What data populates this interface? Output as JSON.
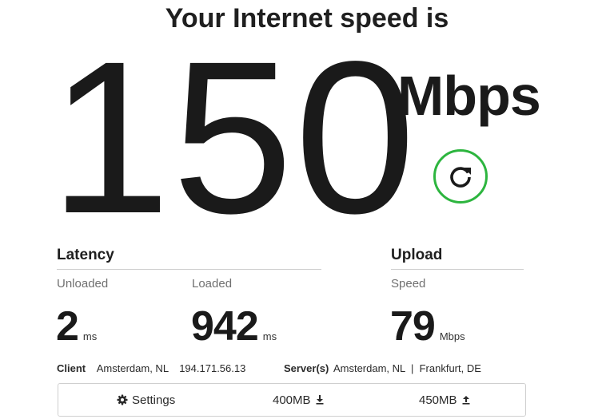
{
  "header": {
    "title": "Your Internet speed is"
  },
  "speed": {
    "value": "150",
    "unit": "Mbps"
  },
  "colors": {
    "accent": "#2db53f",
    "text": "#1a1a1a",
    "muted": "#707070",
    "divider": "#cfcfcf"
  },
  "latency": {
    "title": "Latency",
    "unloaded": {
      "label": "Unloaded",
      "value": "2",
      "unit": "ms"
    },
    "loaded": {
      "label": "Loaded",
      "value": "942",
      "unit": "ms"
    }
  },
  "upload": {
    "title": "Upload",
    "speed": {
      "label": "Speed",
      "value": "79",
      "unit": "Mbps"
    }
  },
  "info": {
    "client_label": "Client",
    "client_location": "Amsterdam, NL",
    "client_ip": "194.171.56.13",
    "server_label": "Server(s)",
    "servers": "Amsterdam, NL  |  Frankfurt, DE"
  },
  "bottom_bar": {
    "settings_label": "Settings",
    "settings_icon": "gear-icon",
    "download_size": "400MB",
    "download_icon": "download-arrow-icon",
    "upload_size": "450MB",
    "upload_icon": "upload-arrow-icon"
  },
  "icons": {
    "refresh": "refresh-icon"
  }
}
